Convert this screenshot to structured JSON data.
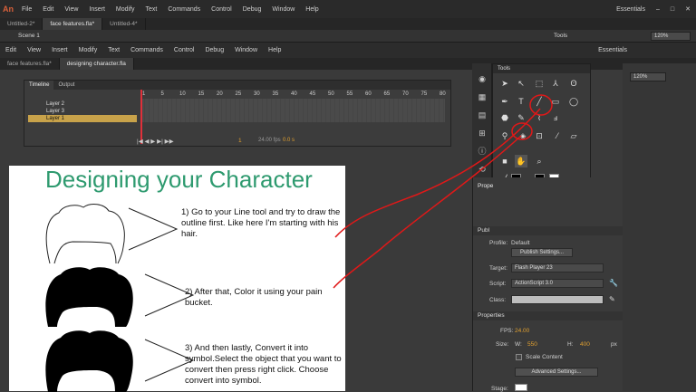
{
  "app": {
    "logo": "An"
  },
  "menu_top": [
    "File",
    "Edit",
    "View",
    "Insert",
    "Modify",
    "Text",
    "Commands",
    "Control",
    "Debug",
    "Window",
    "Help"
  ],
  "workspace": "Essentials",
  "doc_tabs_top": [
    "Untitled-2*",
    "face features.fla*",
    "Untitled-4*"
  ],
  "scene": "Scene 1",
  "menu_second": [
    "Edit",
    "View",
    "Insert",
    "Modify",
    "Text",
    "Commands",
    "Control",
    "Debug",
    "Window",
    "Help"
  ],
  "workspace2": "Essentials",
  "doc_tabs_second": [
    "face features.fla*",
    "designing character.fla"
  ],
  "timeline": {
    "tabs": [
      "Timeline",
      "Output"
    ],
    "layers": [
      "Layer 2",
      "Layer 3",
      "Layer 1"
    ],
    "frame_numbers": [
      "1",
      "5",
      "10",
      "15",
      "20",
      "25",
      "30",
      "35",
      "40",
      "45",
      "50",
      "55",
      "60",
      "65",
      "70",
      "75",
      "80"
    ],
    "current_frame": "1",
    "fps": "24.00 fps",
    "time": "0.0 s"
  },
  "tools_panel": {
    "title": "Tools"
  },
  "zoom": "120%",
  "zoom2": "120%",
  "properties": {
    "title": "Prope",
    "section_publish": "Publ",
    "profile_label": "Profile:",
    "profile_value": "Default",
    "publish_settings": "Publish Settings...",
    "target_label": "Target:",
    "target_value": "Flash Player 23",
    "script_label": "Script:",
    "script_value": "ActionScript 3.0",
    "class_label": "Class:",
    "section_properties": "Properties",
    "fps_label": "FPS:",
    "fps_value": "24.00",
    "size_label": "Size:",
    "w_label": "W:",
    "w_value": "550",
    "h_label": "H:",
    "h_value": "400",
    "px": "px",
    "scale_content": "Scale Content",
    "advanced_settings": "Advanced Settings...",
    "stage_label": "Stage:"
  },
  "stage": {
    "title": "Designing your Character",
    "step1": "1) Go to your Line tool and try to draw the outline first. Like here I'm starting with his hair.",
    "step2": "2) After that, Color it using your pain bucket.",
    "step3": "3) And then lastly, Convert it into symbol.Select the object that you want to convert then press right click. Choose convert into symbol."
  },
  "colors": {
    "accent_title": "#2e9a6f",
    "annotation": "#e01818",
    "selected_layer": "#c8a24a",
    "playhead": "#e0303a"
  }
}
